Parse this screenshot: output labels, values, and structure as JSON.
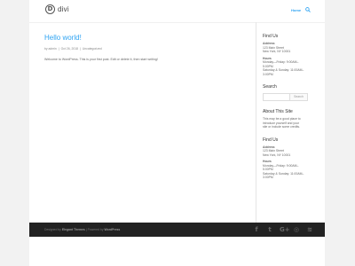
{
  "header": {
    "logo_mark": "D",
    "logo_text": "divi",
    "nav_home": "Home"
  },
  "post": {
    "title": "Hello world!",
    "meta": {
      "by": "by",
      "author": "admin",
      "date": "Oct 26, 2018",
      "category": "Uncategorized"
    },
    "body": "Welcome to WordPress. This is your first post. Edit or delete it, then start writing!"
  },
  "sidebar": {
    "find_us_1": {
      "title": "Find Us",
      "address_label": "Address",
      "address_lines": [
        "123 Main Street",
        "New York, NY 10001"
      ],
      "hours_label": "Hours",
      "hours_lines": [
        "Monday—Friday: 9:00AM–",
        "5:00PM",
        "Saturday & Sunday: 11:00AM–",
        "3:00PM"
      ]
    },
    "search": {
      "title": "Search",
      "button": "Search"
    },
    "about": {
      "title": "About This Site",
      "lines": [
        "This may be a good place to",
        "introduce yourself and your",
        "site or include some credits."
      ]
    },
    "find_us_2": {
      "title": "Find Us",
      "address_label": "Address",
      "address_lines": [
        "123 Main Street",
        "New York, NY 10001"
      ],
      "hours_label": "Hours",
      "hours_lines": [
        "Monday—Friday: 9:00AM–",
        "5:00PM",
        "Saturday & Sunday: 11:00AM–",
        "3:00PM"
      ]
    }
  },
  "footer": {
    "designed_by": "Designed by",
    "theme_author": "Elegant Themes",
    "sep": "|",
    "powered_by": "Powered by",
    "platform": "WordPress",
    "social_icons": [
      "facebook-icon",
      "twitter-icon",
      "google-plus-icon",
      "instagram-icon",
      "rss-icon"
    ],
    "social_glyphs": [
      "f",
      "t",
      "G+",
      "◎",
      "≋"
    ]
  }
}
